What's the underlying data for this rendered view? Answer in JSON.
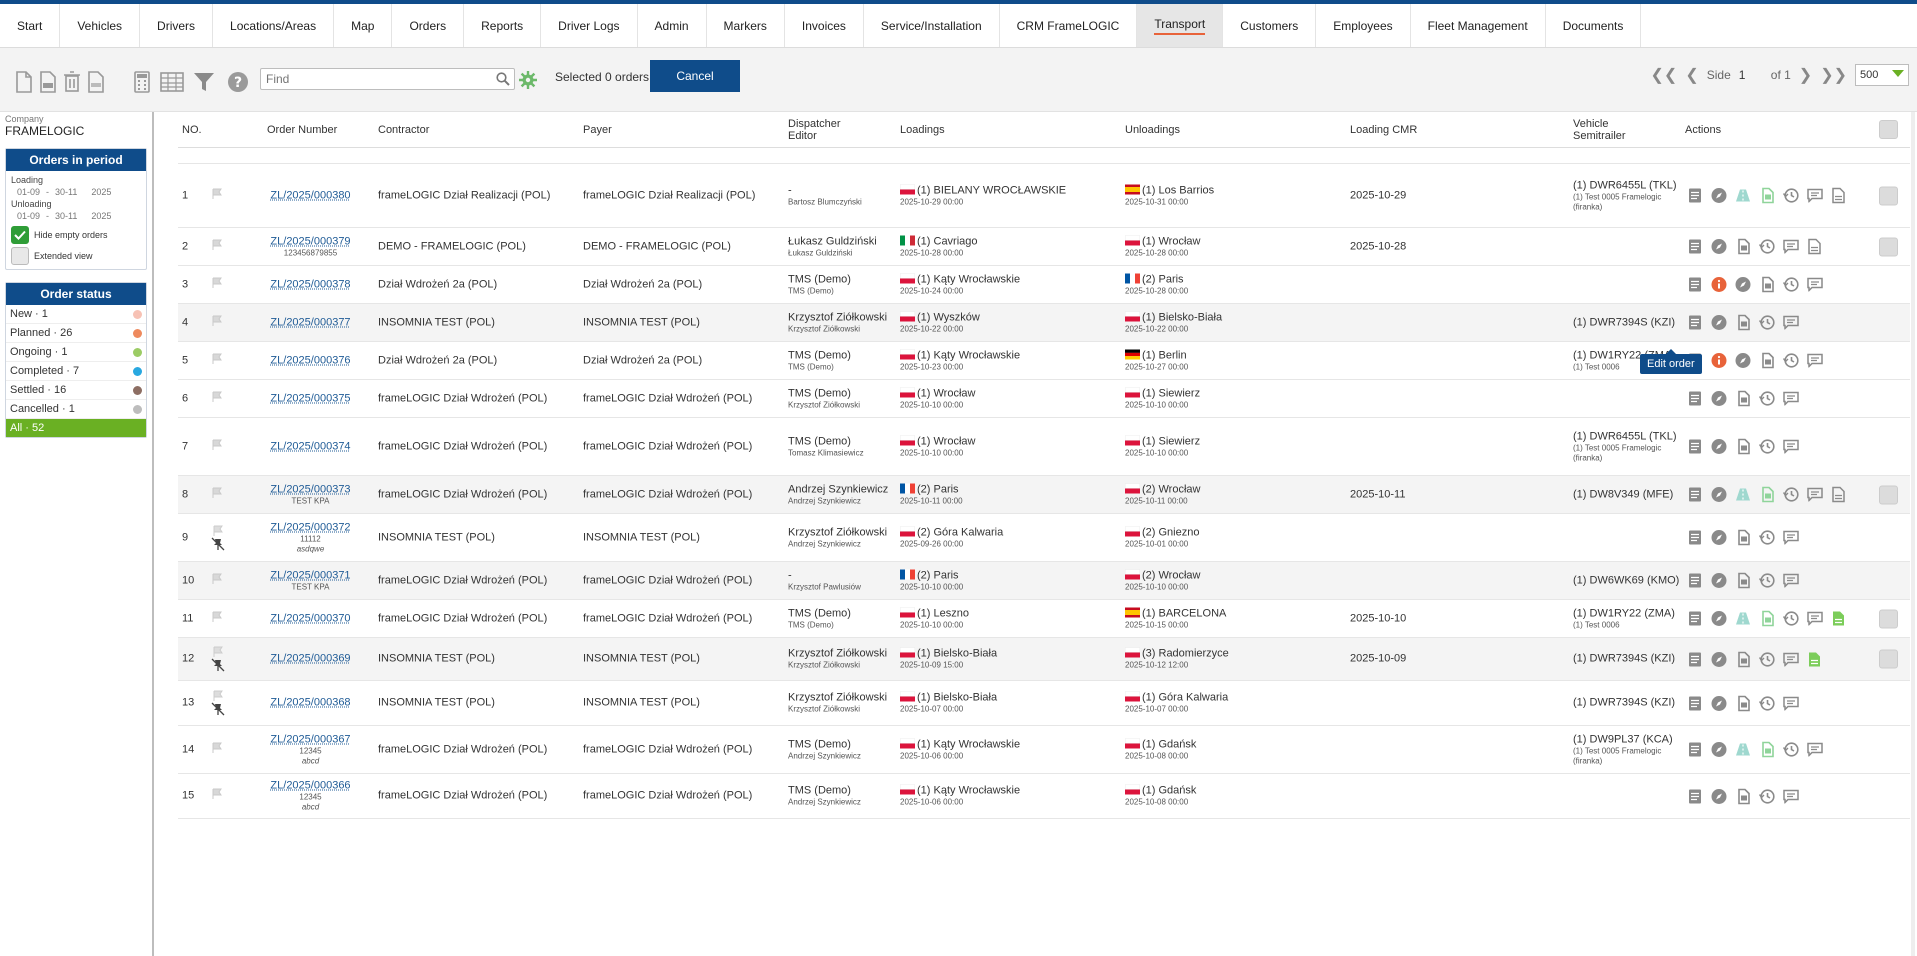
{
  "nav": [
    {
      "label": "Start"
    },
    {
      "label": "Vehicles"
    },
    {
      "label": "Drivers"
    },
    {
      "label": "Locations/Areas"
    },
    {
      "label": "Map"
    },
    {
      "label": "Orders"
    },
    {
      "label": "Reports"
    },
    {
      "label": "Driver Logs"
    },
    {
      "label": "Admin"
    },
    {
      "label": "Markers"
    },
    {
      "label": "Invoices"
    },
    {
      "label": "Service/Installation"
    },
    {
      "label": "CRM FrameLOGIC"
    },
    {
      "label": "Transport",
      "active": true
    },
    {
      "label": "Customers"
    },
    {
      "label": "Employees"
    },
    {
      "label": "Fleet Management"
    },
    {
      "label": "Documents"
    }
  ],
  "toolbar": {
    "find_placeholder": "Find",
    "selected_text": "Selected 0 orders",
    "cancel_label": "Cancel",
    "pager": {
      "side_label": "Side",
      "current_page": "1",
      "of_label": "of 1",
      "page_size": "500"
    }
  },
  "sidebar": {
    "company_label": "Company",
    "company_name": "FRAMELOGIC",
    "period": {
      "title": "Orders in period",
      "loading_label": "Loading",
      "loading_from": "01-09",
      "loading_to": "30-11",
      "loading_year": "2025",
      "unloading_label": "Unloading",
      "unloading_from": "01-09",
      "unloading_to": "30-11",
      "unloading_year": "2025",
      "hide_empty_label": "Hide empty orders",
      "extended_label": "Extended view"
    },
    "status": {
      "title": "Order status",
      "items": [
        {
          "label": "New · 1",
          "color": "#f7c2b5"
        },
        {
          "label": "Planned · 26",
          "color": "#ee8a5e"
        },
        {
          "label": "Ongoing · 1",
          "color": "#9ccc65"
        },
        {
          "label": "Completed · 7",
          "color": "#29a8e0"
        },
        {
          "label": "Settled · 16",
          "color": "#8d6e63"
        },
        {
          "label": "Cancelled · 1",
          "color": "#bdbdbd"
        }
      ],
      "all_label": "All · 52"
    }
  },
  "table": {
    "headers": {
      "no": "NO.",
      "order_number": "Order Number",
      "contractor": "Contractor",
      "payer": "Payer",
      "dispatcher_1": "Dispatcher",
      "dispatcher_2": "Editor",
      "loadings": "Loadings",
      "unloadings": "Unloadings",
      "loading_cmr": "Loading CMR",
      "vehicle_1": "Vehicle",
      "vehicle_2": "Semitrailer",
      "actions": "Actions"
    },
    "rows": [
      {
        "no": "1",
        "order": "ZL/2025/000380",
        "order_sub": "",
        "order_sub2": "",
        "contractor": "frameLOGIC Dział Realizacji (POL)",
        "payer": "frameLOGIC Dział Realizacji (POL)",
        "disp": "-",
        "disp_sub": "Bartosz Blumczyński",
        "load": "(1) BIELANY WROCŁAWSKIE",
        "load_date": "2025-10-29 00:00",
        "load_flag": "pl",
        "unload": "(1) Los Barrios",
        "unload_date": "2025-10-31 00:00",
        "unload_flag": "es",
        "cmr": "2025-10-29",
        "veh": "(1) DWR6455L (TKL)",
        "veh_sub": "(1) Test 0005 Framelogic (firanka)",
        "icons": "full",
        "check": true,
        "flagtype": "flag"
      },
      {
        "no": "2",
        "order": "ZL/2025/000379",
        "order_sub": "123456879855",
        "order_sub2": "",
        "contractor": "DEMO - FRAMELOGIC (POL)",
        "payer": "DEMO - FRAMELOGIC (POL)",
        "disp": "Łukasz Guldziński",
        "disp_sub": "Łukasz Guldziński",
        "load": "(1) Cavriago",
        "load_date": "2025-10-28 00:00",
        "load_flag": "it",
        "unload": "(1) Wrocław",
        "unload_date": "2025-10-28 00:00",
        "unload_flag": "pl",
        "cmr": "2025-10-28",
        "veh": "",
        "veh_sub": "",
        "icons": "doc",
        "check": true,
        "flagtype": "flag"
      },
      {
        "no": "3",
        "order": "ZL/2025/000378",
        "order_sub": "",
        "order_sub2": "",
        "contractor": "Dział Wdrożeń 2a (POL)",
        "payer": "Dział Wdrożeń 2a (POL)",
        "disp": "TMS (Demo)",
        "disp_sub": "TMS (Demo)",
        "load": "(1) Kąty Wrocławskie",
        "load_date": "2025-10-24 00:00",
        "load_flag": "pl",
        "unload": "(2) Paris",
        "unload_date": "2025-10-28 00:00",
        "unload_flag": "fr",
        "cmr": "",
        "veh": "",
        "veh_sub": "",
        "icons": "info",
        "check": false,
        "flagtype": "flag"
      },
      {
        "no": "4",
        "order": "ZL/2025/000377",
        "order_sub": "",
        "order_sub2": "",
        "contractor": "INSOMNIA TEST (POL)",
        "payer": "INSOMNIA TEST (POL)",
        "disp": "Krzysztof Ziółkowski",
        "disp_sub": "Krzysztof Ziółkowski",
        "load": "(1) Wyszków",
        "load_date": "2025-10-22 00:00",
        "load_flag": "pl",
        "unload": "(1) Bielsko-Biała",
        "unload_date": "2025-10-22 00:00",
        "unload_flag": "pl",
        "cmr": "",
        "veh": "(1) DWR7394S (KZI)",
        "veh_sub": "",
        "icons": "basic",
        "check": false,
        "flagtype": "flag",
        "shade": true
      },
      {
        "no": "5",
        "order": "ZL/2025/000376",
        "order_sub": "",
        "order_sub2": "",
        "contractor": "Dział Wdrożeń 2a (POL)",
        "payer": "Dział Wdrożeń 2a (POL)",
        "disp": "TMS (Demo)",
        "disp_sub": "TMS (Demo)",
        "load": "(1) Kąty Wrocławskie",
        "load_date": "2025-10-23 00:00",
        "load_flag": "pl",
        "unload": "(1) Berlin",
        "unload_date": "2025-10-27 00:00",
        "unload_flag": "de",
        "cmr": "",
        "veh": "(1) DW1RY22 (ZMA)",
        "veh_sub": "(1) Test 0006",
        "icons": "info",
        "check": false,
        "flagtype": "flag"
      },
      {
        "no": "6",
        "order": "ZL/2025/000375",
        "order_sub": "",
        "order_sub2": "",
        "contractor": "frameLOGIC Dział Wdrożeń (POL)",
        "payer": "frameLOGIC Dział Wdrożeń (POL)",
        "disp": "TMS (Demo)",
        "disp_sub": "Krzysztof Ziółkowski",
        "load": "(1) Wrocław",
        "load_date": "2025-10-10 00:00",
        "load_flag": "pl",
        "unload": "(1) Siewierz",
        "unload_date": "2025-10-10 00:00",
        "unload_flag": "pl",
        "cmr": "",
        "veh": "",
        "veh_sub": "",
        "icons": "basic",
        "check": false,
        "flagtype": "flag"
      },
      {
        "no": "7",
        "order": "ZL/2025/000374",
        "order_sub": "",
        "order_sub2": "",
        "contractor": "frameLOGIC Dział Wdrożeń (POL)",
        "payer": "frameLOGIC Dział Wdrożeń (POL)",
        "disp": "TMS (Demo)",
        "disp_sub": "Tomasz Klimasiewicz",
        "load": "(1) Wrocław",
        "load_date": "2025-10-10 00:00",
        "load_flag": "pl",
        "unload": "(1) Siewierz",
        "unload_date": "2025-10-10 00:00",
        "unload_flag": "pl",
        "cmr": "",
        "veh": "(1) DWR6455L (TKL)",
        "veh_sub": "(1) Test 0005 Framelogic (firanka)",
        "icons": "basic",
        "check": false,
        "flagtype": "flag"
      },
      {
        "no": "8",
        "order": "ZL/2025/000373",
        "order_sub": "TEST KPA",
        "order_sub2": "",
        "contractor": "frameLOGIC Dział Wdrożeń (POL)",
        "payer": "frameLOGIC Dział Wdrożeń (POL)",
        "disp": "Andrzej Szynkiewicz",
        "disp_sub": "Andrzej Szynkiewicz",
        "load": "(2) Paris",
        "load_date": "2025-10-11 00:00",
        "load_flag": "fr",
        "unload": "(2) Wrocław",
        "unload_date": "2025-10-11 00:00",
        "unload_flag": "pl",
        "cmr": "2025-10-11",
        "veh": "(1) DW8V349 (MFE)",
        "veh_sub": "",
        "icons": "full",
        "check": true,
        "flagtype": "flag",
        "shade": true
      },
      {
        "no": "9",
        "order": "ZL/2025/000372",
        "order_sub": "11112",
        "order_sub2": "asdqwe",
        "contractor": "INSOMNIA TEST (POL)",
        "payer": "INSOMNIA TEST (POL)",
        "disp": "Krzysztof Ziółkowski",
        "disp_sub": "Andrzej Szynkiewicz",
        "load": "(2) Góra Kalwaria",
        "load_date": "2025-09-26 00:00",
        "load_flag": "pl",
        "unload": "(2) Gniezno",
        "unload_date": "2025-10-01 00:00",
        "unload_flag": "pl",
        "cmr": "",
        "veh": "",
        "veh_sub": "",
        "icons": "basic",
        "check": false,
        "flagtype": "pin"
      },
      {
        "no": "10",
        "order": "ZL/2025/000371",
        "order_sub": "TEST KPA",
        "order_sub2": "",
        "contractor": "frameLOGIC Dział Wdrożeń (POL)",
        "payer": "frameLOGIC Dział Wdrożeń (POL)",
        "disp": "-",
        "disp_sub": "Krzysztof Pawlusiów",
        "load": "(2) Paris",
        "load_date": "2025-10-10 00:00",
        "load_flag": "fr",
        "unload": "(2) Wrocław",
        "unload_date": "2025-10-10 00:00",
        "unload_flag": "pl",
        "cmr": "",
        "veh": "(1) DW6WK69 (KMO)",
        "veh_sub": "",
        "icons": "basic",
        "check": false,
        "flagtype": "flag",
        "shade": true
      },
      {
        "no": "11",
        "order": "ZL/2025/000370",
        "order_sub": "",
        "order_sub2": "",
        "contractor": "frameLOGIC Dział Wdrożeń (POL)",
        "payer": "frameLOGIC Dział Wdrożeń (POL)",
        "disp": "TMS (Demo)",
        "disp_sub": "TMS (Demo)",
        "load": "(1) Leszno",
        "load_date": "2025-10-10 00:00",
        "load_flag": "pl",
        "unload": "(1) BARCELONA",
        "unload_date": "2025-10-15 00:00",
        "unload_flag": "es",
        "cmr": "2025-10-10",
        "veh": "(1) DW1RY22 (ZMA)",
        "veh_sub": "(1) Test 0006",
        "icons": "full2",
        "check": true,
        "flagtype": "flag"
      },
      {
        "no": "12",
        "order": "ZL/2025/000369",
        "order_sub": "",
        "order_sub2": "",
        "contractor": "INSOMNIA TEST (POL)",
        "payer": "INSOMNIA TEST (POL)",
        "disp": "Krzysztof Ziółkowski",
        "disp_sub": "Krzysztof Ziółkowski",
        "load": "(1) Bielsko-Biała",
        "load_date": "2025-10-09 15:00",
        "load_flag": "pl",
        "unload": "(3) Radomierzyce",
        "unload_date": "2025-10-12 12:00",
        "unload_flag": "pl",
        "cmr": "2025-10-09",
        "veh": "(1) DWR7394S (KZI)",
        "veh_sub": "",
        "icons": "greendoc",
        "check": true,
        "flagtype": "pin",
        "shade": true
      },
      {
        "no": "13",
        "order": "ZL/2025/000368",
        "order_sub": "",
        "order_sub2": "",
        "contractor": "INSOMNIA TEST (POL)",
        "payer": "INSOMNIA TEST (POL)",
        "disp": "Krzysztof Ziółkowski",
        "disp_sub": "Krzysztof Ziółkowski",
        "load": "(1) Bielsko-Biała",
        "load_date": "2025-10-07 00:00",
        "load_flag": "pl",
        "unload": "(1) Góra Kalwaria",
        "unload_date": "2025-10-07 00:00",
        "unload_flag": "pl",
        "cmr": "",
        "veh": "(1) DWR7394S (KZI)",
        "veh_sub": "",
        "icons": "basic",
        "check": false,
        "flagtype": "pin"
      },
      {
        "no": "14",
        "order": "ZL/2025/000367",
        "order_sub": "12345",
        "order_sub2": "abcd",
        "contractor": "frameLOGIC Dział Wdrożeń (POL)",
        "payer": "frameLOGIC Dział Wdrożeń (POL)",
        "disp": "TMS (Demo)",
        "disp_sub": "Andrzej Szynkiewicz",
        "load": "(1) Kąty Wrocławskie",
        "load_date": "2025-10-06 00:00",
        "load_flag": "pl",
        "unload": "(1) Gdańsk",
        "unload_date": "2025-10-08 00:00",
        "unload_flag": "pl",
        "cmr": "",
        "veh": "(1) DW9PL37 (KCA)",
        "veh_sub": "(1) Test 0005 Framelogic (firanka)",
        "icons": "green",
        "check": false,
        "flagtype": "flag"
      },
      {
        "no": "15",
        "order": "ZL/2025/000366",
        "order_sub": "12345",
        "order_sub2": "abcd",
        "contractor": "frameLOGIC Dział Wdrożeń (POL)",
        "payer": "frameLOGIC Dział Wdrożeń (POL)",
        "disp": "TMS (Demo)",
        "disp_sub": "Andrzej Szynkiewicz",
        "load": "(1) Kąty Wrocławskie",
        "load_date": "2025-10-06 00:00",
        "load_flag": "pl",
        "unload": "(1) Gdańsk",
        "unload_date": "2025-10-08 00:00",
        "unload_flag": "pl",
        "cmr": "",
        "veh": "",
        "veh_sub": "",
        "icons": "basic",
        "check": false,
        "flagtype": "flag"
      }
    ]
  },
  "tooltip": {
    "text": "Edit order"
  },
  "colors": {
    "brand": "#0f4c8a",
    "accent": "#e8633a",
    "all_status": "#6ab023"
  }
}
